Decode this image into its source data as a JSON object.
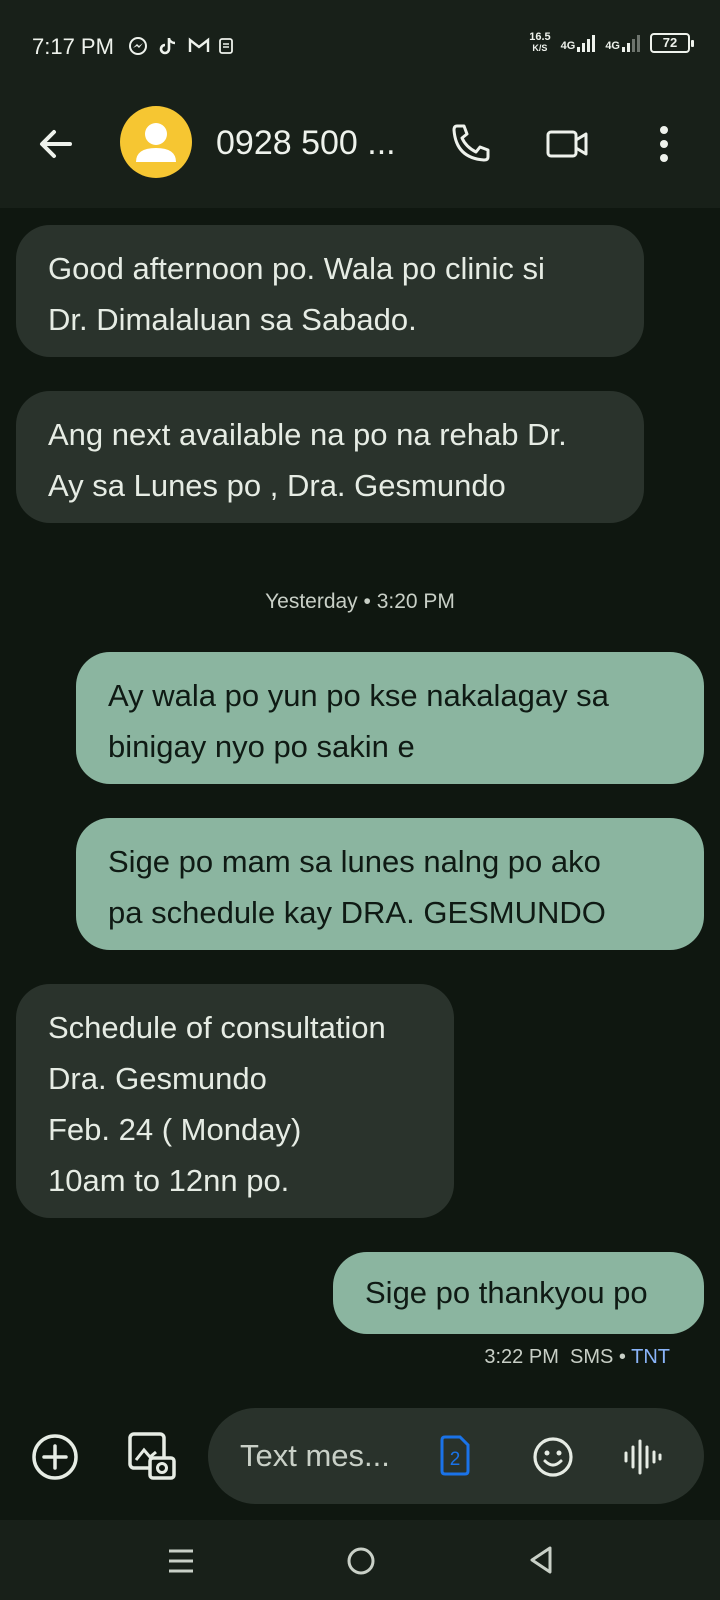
{
  "status_bar": {
    "time": "7:17 PM",
    "speed_value": "16.5",
    "speed_unit": "K/S",
    "network_1": "4G",
    "network_2": "4G",
    "battery": "72"
  },
  "header": {
    "contact_name": "0928 500 ..."
  },
  "messages": [
    {
      "direction": "incoming",
      "lines": [
        "Good afternoon po. Wala po clinic si",
        "Dr. Dimalaluan sa Sabado."
      ]
    },
    {
      "direction": "incoming",
      "lines": [
        "Ang next available na po na rehab Dr.",
        "Ay sa Lunes po , Dra. Gesmundo"
      ]
    },
    {
      "direction": "outgoing",
      "lines": [
        "Ay wala po yun po kse nakalagay sa",
        "binigay nyo po sakin e"
      ]
    },
    {
      "direction": "outgoing",
      "lines": [
        "Sige po mam sa lunes nalng po ako",
        "pa schedule kay DRA. GESMUNDO"
      ]
    },
    {
      "direction": "incoming",
      "lines": [
        "Schedule of consultation",
        "Dra. Gesmundo",
        "Feb. 24 ( Monday)",
        "10am to 12nn po."
      ]
    },
    {
      "direction": "outgoing",
      "lines": [
        "Sige po thankyou po"
      ]
    }
  ],
  "divider": "Yesterday • 3:20 PM",
  "last_message_meta": {
    "time": "3:22 PM",
    "type": "SMS",
    "separator": "•",
    "carrier": "TNT"
  },
  "compose": {
    "placeholder": "Text mes...",
    "sim_number": "2"
  },
  "colors": {
    "background": "#0f1710",
    "bar": "#182019",
    "incoming_bubble": "#2a332c",
    "outgoing_bubble": "#8bb5a0",
    "avatar": "#f6c632",
    "carrier_link": "#8ab4f8",
    "sim_icon": "#1a73e8"
  },
  "icons": [
    "back-arrow-icon",
    "avatar-person-icon",
    "phone-icon",
    "video-camera-icon",
    "more-vert-icon",
    "add-circle-icon",
    "gallery-camera-icon",
    "sim-icon",
    "emoji-icon",
    "voice-wave-icon",
    "nav-menu-icon",
    "nav-home-icon",
    "nav-back-icon"
  ]
}
